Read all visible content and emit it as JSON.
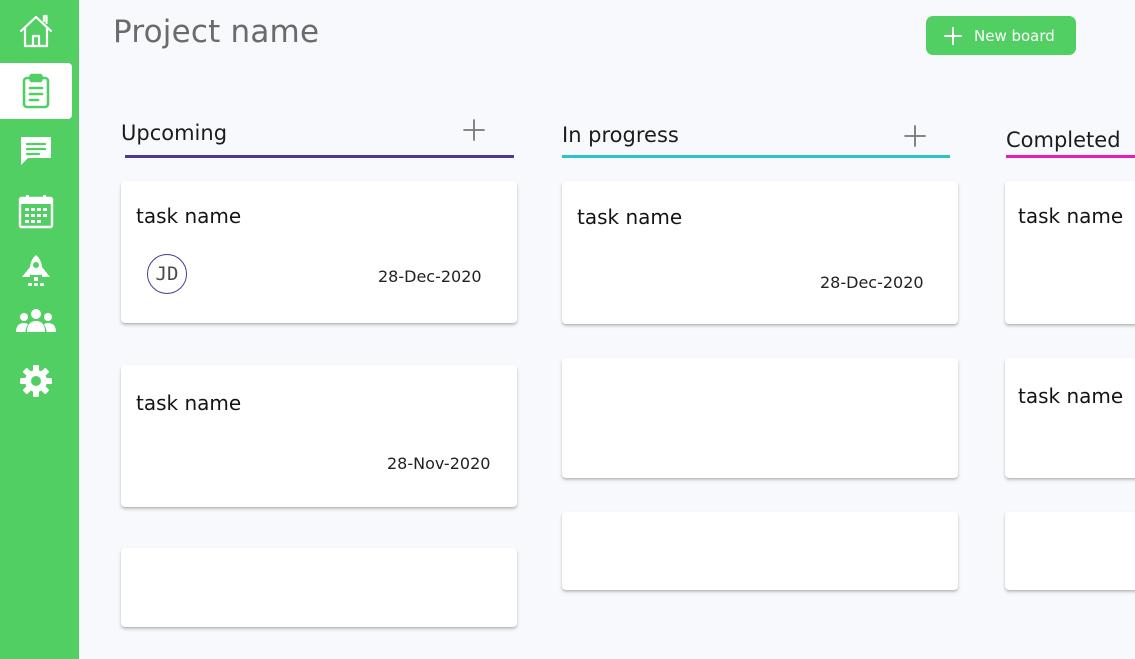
{
  "sidebar": {
    "items": [
      {
        "icon": "home-icon",
        "active": false
      },
      {
        "icon": "clipboard-icon",
        "active": true
      },
      {
        "icon": "chat-icon",
        "active": false
      },
      {
        "icon": "calendar-icon",
        "active": false
      },
      {
        "icon": "rocket-icon",
        "active": false
      },
      {
        "icon": "team-icon",
        "active": false
      },
      {
        "icon": "gear-icon",
        "active": false
      }
    ]
  },
  "header": {
    "title": "Project name",
    "new_board_label": "New board"
  },
  "columns": [
    {
      "title": "Upcoming",
      "color": "#4b3a8f",
      "cards": [
        {
          "task": "task name",
          "date": "28-Dec-2020",
          "avatar": "JD"
        },
        {
          "task": "task name",
          "date": "28-Nov-2020"
        },
        {
          "task": "",
          "date": ""
        }
      ]
    },
    {
      "title": "In progress",
      "color": "#2ec4c4",
      "cards": [
        {
          "task": "task name",
          "date": "28-Dec-2020"
        },
        {
          "task": "",
          "date": ""
        },
        {
          "task": "",
          "date": ""
        }
      ]
    },
    {
      "title": "Completed",
      "color": "#e91eb8",
      "cards": [
        {
          "task": "task name",
          "date": ""
        },
        {
          "task": "task name",
          "date": ""
        },
        {
          "task": "",
          "date": ""
        }
      ]
    }
  ],
  "colors": {
    "accent": "#52cf63",
    "background": "#f8f9fc"
  }
}
